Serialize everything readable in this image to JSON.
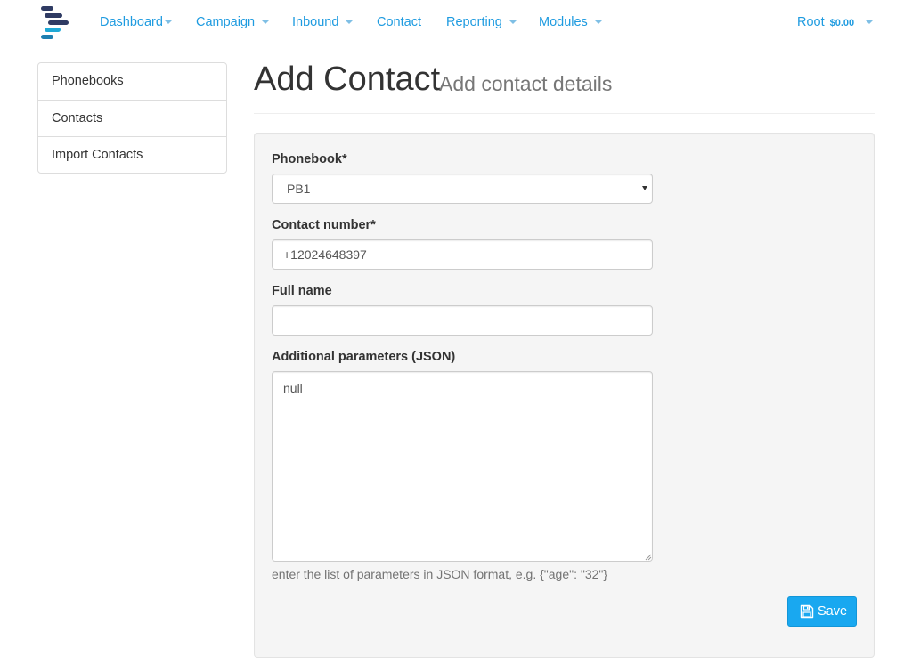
{
  "nav": {
    "items": [
      {
        "label": "Dashboard"
      },
      {
        "label": "Campaign"
      },
      {
        "label": "Inbound"
      },
      {
        "label": "Contact"
      },
      {
        "label": "Reporting"
      },
      {
        "label": "Modules"
      }
    ],
    "user": {
      "label": "Root",
      "balance": "$0.00"
    }
  },
  "sidebar": {
    "items": [
      {
        "label": "Phonebooks"
      },
      {
        "label": "Contacts"
      },
      {
        "label": "Import Contacts"
      }
    ]
  },
  "page": {
    "title": "Add Contact",
    "subtitle": "Add contact details"
  },
  "form": {
    "phonebook": {
      "label": "Phonebook*",
      "value": "PB1"
    },
    "contact_number": {
      "label": "Contact number*",
      "value": "+12024648397"
    },
    "full_name": {
      "label": "Full name",
      "value": ""
    },
    "additional_params": {
      "label": "Additional parameters (JSON)",
      "value": "null"
    },
    "help_text": "enter the list of parameters in JSON format, e.g. {\"age\": \"32\"}",
    "save_label": "Save"
  },
  "colors": {
    "accent": "#1e9be0",
    "button": "#19a8f0",
    "navbar_border": "#41a4b8"
  },
  "icons": {
    "logo": "logo-icon",
    "save": "floppy-disk-icon"
  }
}
